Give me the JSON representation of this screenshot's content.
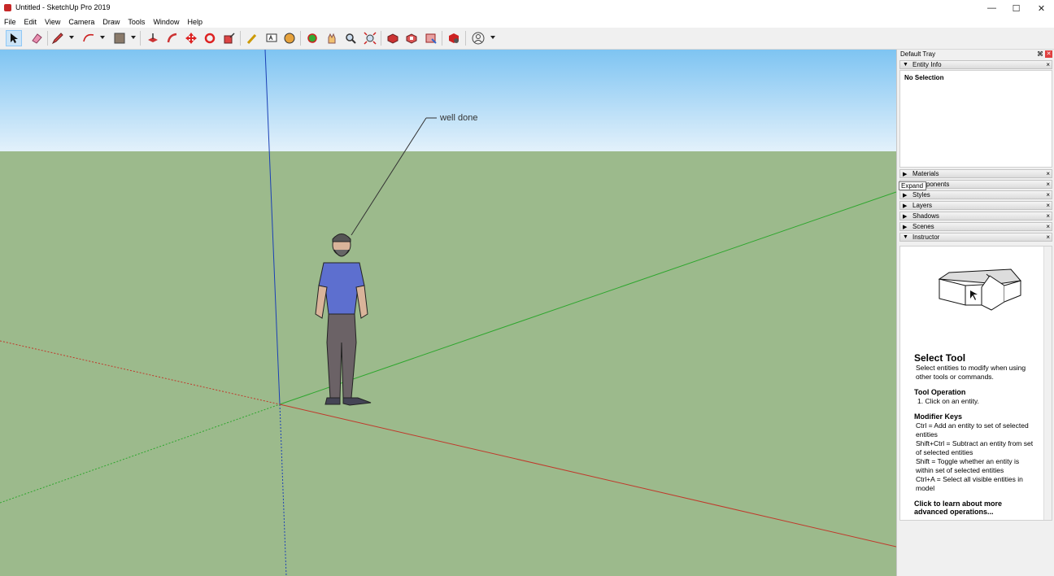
{
  "window": {
    "title": "Untitled - SketchUp Pro 2019"
  },
  "menu": [
    "File",
    "Edit",
    "View",
    "Camera",
    "Draw",
    "Tools",
    "Window",
    "Help"
  ],
  "toolbar": {
    "icons": [
      "select-icon",
      "eraser-icon",
      "pencil-icon",
      "arc-icon",
      "paint-bucket-icon",
      "push-pull-icon",
      "follow-me-icon",
      "move-icon",
      "rotate-icon",
      "scale-icon",
      "tape-measure-icon",
      "text-icon",
      "protractor-icon",
      "orbit-icon",
      "pan-icon",
      "zoom-icon",
      "zoom-extents-icon",
      "3d-warehouse-icon",
      "extension-warehouse-icon",
      "layout-icon",
      "extension-manager-icon",
      "account-icon"
    ]
  },
  "viewport": {
    "annotation": "well done",
    "sky_color": "#7ec4f2",
    "ground_color": "#9cba8c",
    "axis_colors": {
      "red": "#c0392b",
      "green": "#2ea62e",
      "blue": "#1a3fb5"
    }
  },
  "tray": {
    "title": "Default Tray",
    "entity_info": {
      "label": "Entity Info",
      "status": "No Selection"
    },
    "panels": [
      {
        "label": "Materials"
      },
      {
        "label": "Components"
      },
      {
        "label": "Styles"
      },
      {
        "label": "Layers"
      },
      {
        "label": "Shadows"
      },
      {
        "label": "Scenes"
      },
      {
        "label": "Instructor"
      }
    ],
    "tooltip": "Expand",
    "instructor": {
      "title": "Select Tool",
      "desc": "Select entities to modify when using other tools or commands.",
      "op_title": "Tool Operation",
      "op_text": "1. Click on an entity.",
      "mod_title": "Modifier Keys",
      "mod_lines": [
        "Ctrl = Add an entity to set of selected entities",
        "Shift+Ctrl = Subtract an entity from set of selected entities",
        "Shift = Toggle whether an entity is within set of selected entities",
        "Ctrl+A = Select all visible entities in model"
      ],
      "link": "Click to learn about more advanced operations..."
    }
  }
}
